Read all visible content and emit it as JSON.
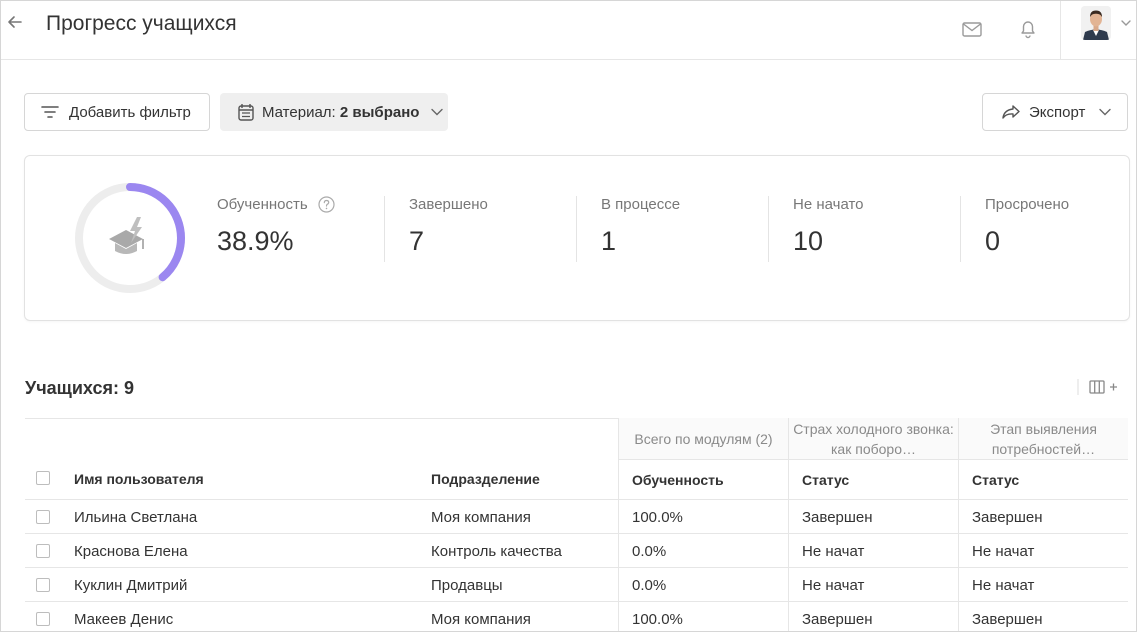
{
  "header": {
    "title": "Прогресс учащихся",
    "back_icon": "arrow-left-icon",
    "mail_icon": "mail-icon",
    "bell_icon": "bell-icon"
  },
  "toolbar": {
    "add_filter_label": "Добавить фильтр",
    "material_label_prefix": "Материал:",
    "material_label_value": "2 выбрано",
    "export_label": "Экспорт"
  },
  "stats": {
    "progress_label": "Обученность",
    "progress_value": "38.9%",
    "progress_fraction": 0.389,
    "items": [
      {
        "label": "Завершено",
        "value": "7"
      },
      {
        "label": "В процессе",
        "value": "1"
      },
      {
        "label": "Не начато",
        "value": "10"
      },
      {
        "label": "Просрочено",
        "value": "0"
      }
    ]
  },
  "students": {
    "count_label": "Учащихся: 9"
  },
  "table": {
    "group_headers": [
      "Всего по модулям (2)",
      "Страх холодного звонка: как поборо…",
      "Этап выявления потребностей…"
    ],
    "headers": [
      "Имя пользователя",
      "Подразделение",
      "Обученность",
      "Статус",
      "Статус"
    ],
    "rows": [
      [
        "Ильина Светлана",
        "Моя компания",
        "100.0%",
        "Завершен",
        "Завершен"
      ],
      [
        "Краснова Елена",
        "Контроль качества",
        "0.0%",
        "Не начат",
        "Не начат"
      ],
      [
        "Куклин Дмитрий",
        "Продавцы",
        "0.0%",
        "Не начат",
        "Не начат"
      ],
      [
        "Макеев Денис",
        "Моя компания",
        "100.0%",
        "Завершен",
        "Завершен"
      ]
    ]
  },
  "colors": {
    "accent": "#9b87f0",
    "track": "#ededed"
  }
}
